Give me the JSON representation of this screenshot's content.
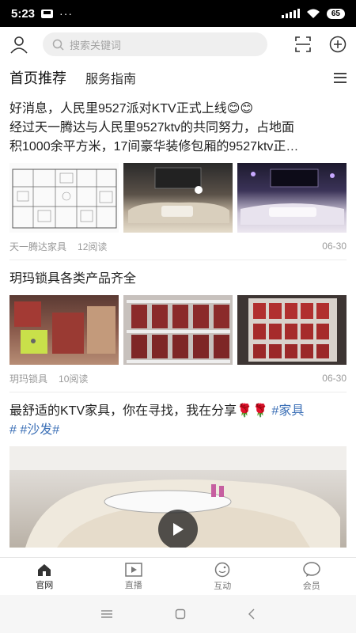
{
  "status_bar": {
    "time": "5:23",
    "dots": "···",
    "battery": "65"
  },
  "search": {
    "placeholder": "搜索关键词"
  },
  "tabs": {
    "active": "首页推荐",
    "second": "服务指南"
  },
  "posts": [
    {
      "title": "好消息，人民里9527派对KTV正式上线😊😊",
      "body_line1": "经过天一腾达与人民里9527ktv的共同努力，占地面",
      "body_line2": "积1000余平方米，17间豪华装修包厢的9527ktv正…",
      "source": "天一腾达家具",
      "reads": "12阅读",
      "date": "06-30"
    },
    {
      "title": "玥玛锁具各类产品齐全",
      "source": "玥玛锁具",
      "reads": "10阅读",
      "date": "06-30"
    },
    {
      "title_line1": "最舒适的KTV家具，你在寻找，我在分享🌹🌹",
      "tag1": "#家具",
      "tag2": "#",
      "tag3": "#沙发#"
    }
  ],
  "bottom_nav": [
    {
      "label": "官网",
      "icon": "home-icon"
    },
    {
      "label": "直播",
      "icon": "live-play-icon"
    },
    {
      "label": "互动",
      "icon": "interaction-icon"
    },
    {
      "label": "会员",
      "icon": "member-chat-icon"
    }
  ],
  "colors": {
    "accent_tag": "#3b6fb6",
    "active_nav": "#222222",
    "inactive_nav": "#777777"
  }
}
